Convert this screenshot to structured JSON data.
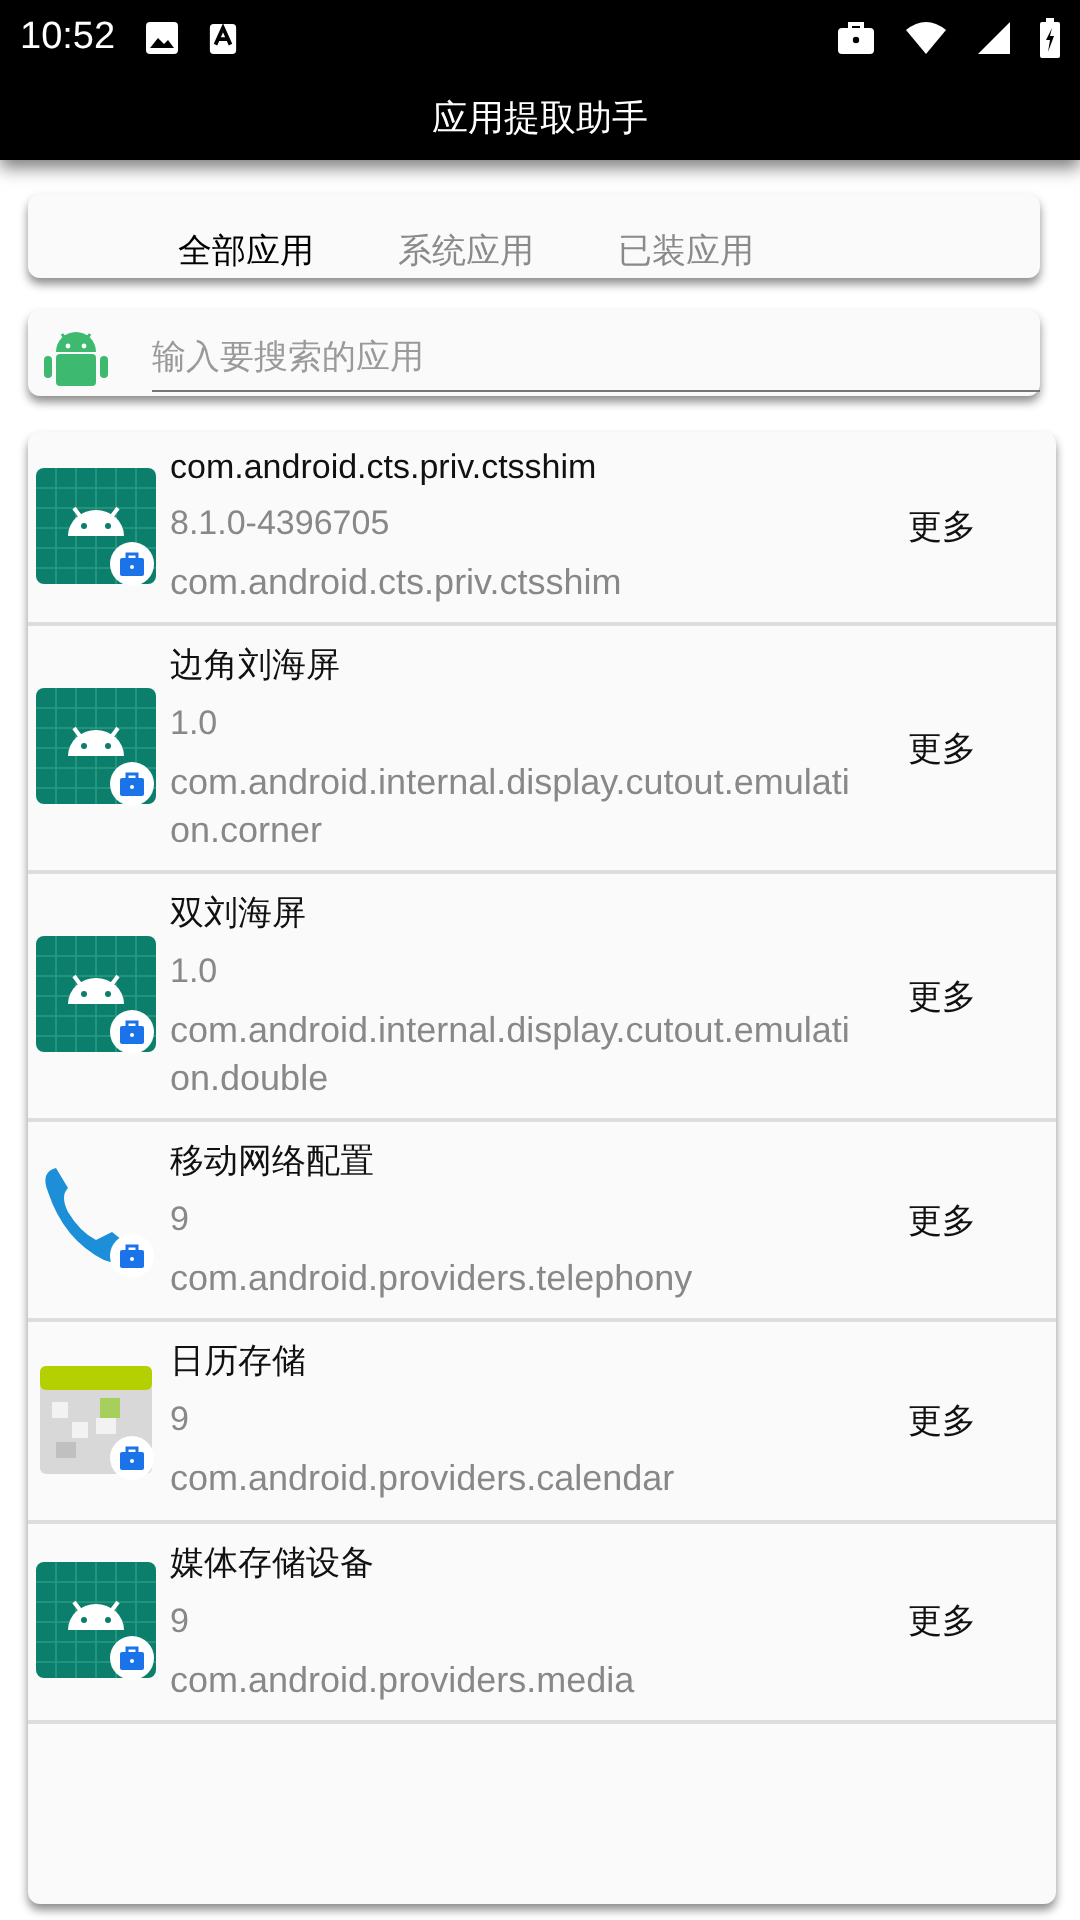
{
  "status_bar": {
    "time": "10:52"
  },
  "app_bar": {
    "title": "应用提取助手"
  },
  "tabs": [
    {
      "label": "全部应用",
      "selected": true
    },
    {
      "label": "系统应用",
      "selected": false
    },
    {
      "label": "已装应用",
      "selected": false
    }
  ],
  "search": {
    "placeholder": "输入要搜索的应用"
  },
  "apps": [
    {
      "kind": "android",
      "name": "com.android.cts.priv.ctsshim",
      "version": "8.1.0-4396705",
      "package": "com.android.cts.priv.ctsshim",
      "action": "更多"
    },
    {
      "kind": "android",
      "name": "边角刘海屏",
      "version": "1.0",
      "package": "com.android.internal.display.cutout.emulation.corner",
      "action": "更多"
    },
    {
      "kind": "android",
      "name": "双刘海屏",
      "version": "1.0",
      "package": "com.android.internal.display.cutout.emulation.double",
      "action": "更多"
    },
    {
      "kind": "phone",
      "name": "移动网络配置",
      "version": "9",
      "package": "com.android.providers.telephony",
      "action": "更多"
    },
    {
      "kind": "calendar",
      "name": "日历存储",
      "version": "9",
      "package": "com.android.providers.calendar",
      "action": "更多"
    },
    {
      "kind": "android",
      "name": "媒体存储设备",
      "version": "9",
      "package": "com.android.providers.media",
      "action": "更多"
    }
  ]
}
